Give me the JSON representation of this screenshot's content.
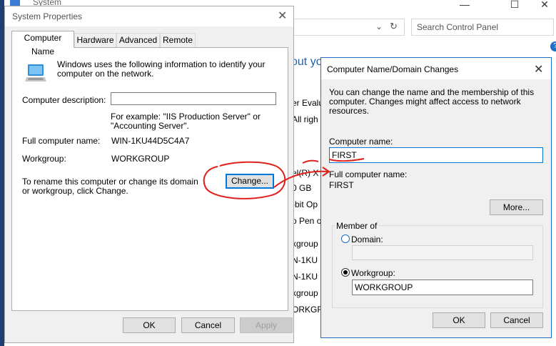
{
  "background_window": {
    "title": "System",
    "search_placeholder": "Search Control Panel",
    "heading_fragment": "out yo",
    "help_glyph": "?",
    "text_fragments": [
      "er Evalu",
      "All righ",
      "el(R) X",
      "0 GB",
      "-bit Op",
      "o Pen o",
      "kgroup",
      "N-1KU",
      "N-1KU",
      "kgroup",
      "ORKGR"
    ]
  },
  "system_properties": {
    "title": "System Properties",
    "tabs": [
      "Computer Name",
      "Hardware",
      "Advanced",
      "Remote"
    ],
    "intro": "Windows uses the following information to identify your computer on the network.",
    "description_label": "Computer description:",
    "description_value": "",
    "example": "For example: \"IIS Production Server\" or \"Accounting Server\".",
    "full_name_label": "Full computer name:",
    "full_name_value": "WIN-1KU44D5C4A7",
    "workgroup_label": "Workgroup:",
    "workgroup_value": "WORKGROUP",
    "rename_text": "To rename this computer or change its domain or workgroup, click Change.",
    "change_button": "Change...",
    "ok_button": "OK",
    "cancel_button": "Cancel",
    "apply_button": "Apply"
  },
  "domain_changes": {
    "title": "Computer Name/Domain Changes",
    "intro": "You can change the name and the membership of this computer. Changes might affect access to network resources.",
    "computer_name_label": "Computer name:",
    "computer_name_value": "FIRST",
    "full_name_label": "Full computer name:",
    "full_name_value": "FIRST",
    "more_button": "More...",
    "member_of_label": "Member of",
    "domain_label": "Domain:",
    "domain_value": "",
    "workgroup_label": "Workgroup:",
    "workgroup_value": "WORKGROUP",
    "ok_button": "OK",
    "cancel_button": "Cancel"
  },
  "colors": {
    "accent": "#0078d7",
    "annotation": "#e0201a"
  }
}
